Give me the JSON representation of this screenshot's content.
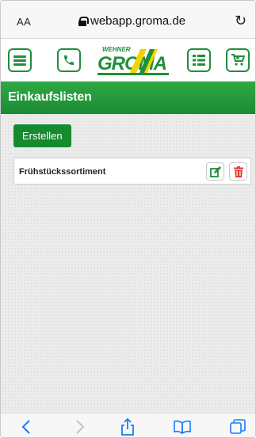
{
  "browser": {
    "text_size_label": "AA",
    "url": "webapp.groma.de"
  },
  "toolbar": {
    "logo_top_text": "WEHNER",
    "logo_main_text": "GROMA"
  },
  "page": {
    "title": "Einkaufslisten"
  },
  "actions": {
    "create_label": "Erstellen"
  },
  "lists": [
    {
      "name": "Frühstückssortiment"
    }
  ],
  "colors": {
    "brand_green": "#1f8f3a",
    "header_green": "#2fa844",
    "logo_yellow": "#f2d400",
    "delete_red": "#e53935",
    "safari_blue": "#1a7cf5"
  }
}
